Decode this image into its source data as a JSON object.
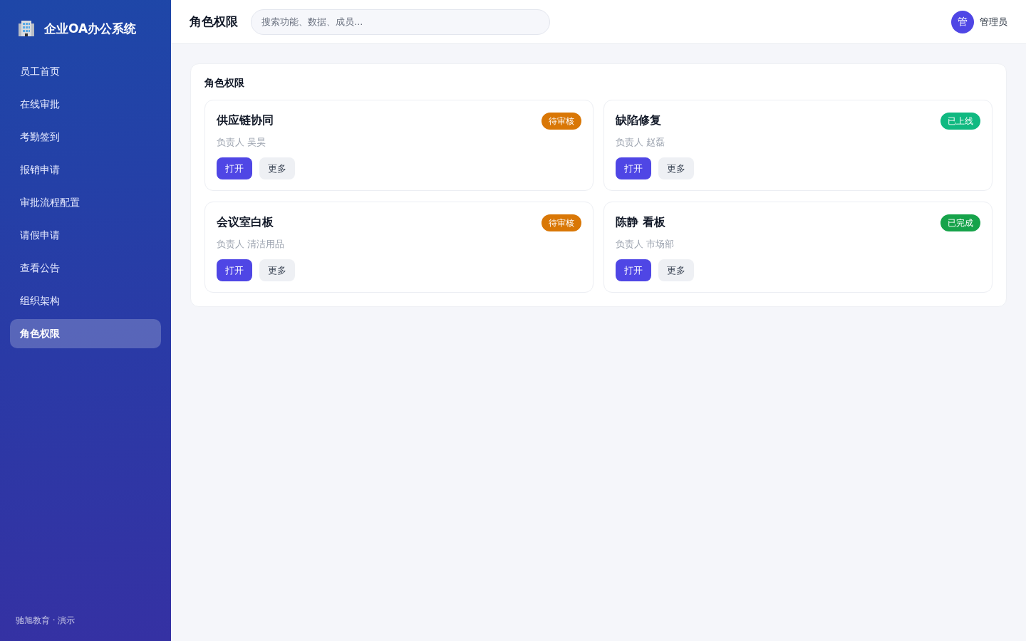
{
  "sidebar": {
    "logo": {
      "title": "企业OA办公系统"
    },
    "items": [
      {
        "label": "员工首页",
        "selected": false
      },
      {
        "label": "在线审批",
        "selected": false
      },
      {
        "label": "考勤签到",
        "selected": false
      },
      {
        "label": "报销申请",
        "selected": false
      },
      {
        "label": "审批流程配置",
        "selected": false
      },
      {
        "label": "请假申请",
        "selected": false
      },
      {
        "label": "查看公告",
        "selected": false
      },
      {
        "label": "组织架构",
        "selected": false
      },
      {
        "label": "角色权限",
        "selected": true
      }
    ],
    "footer": "驰旭教育 · 演示"
  },
  "header": {
    "title": "角色权限",
    "search": {
      "placeholder": "搜索功能、数据、成员..."
    },
    "user": {
      "avatar": "管",
      "name": "管理员"
    }
  },
  "panel": {
    "title": "角色权限",
    "cards": [
      {
        "title": "供应链协同",
        "owner": "负责人 吴昊",
        "badge": {
          "text": "待审核",
          "color": "#d97706"
        },
        "buttons": [
          "打开",
          "更多"
        ]
      },
      {
        "title": "缺陷修复",
        "owner": "负责人 赵磊",
        "badge": {
          "text": "已上线",
          "color": "#10b981"
        },
        "buttons": [
          "打开",
          "更多"
        ]
      },
      {
        "title": "会议室白板",
        "owner": "负责人 清洁用品",
        "badge": {
          "text": "待审核",
          "color": "#d97706"
        },
        "buttons": [
          "打开",
          "更多"
        ]
      },
      {
        "title": "陈静 看板",
        "owner": "负责人 市场部",
        "badge": {
          "text": "已完成",
          "color": "#16a34a"
        },
        "buttons": [
          "打开",
          "更多"
        ]
      }
    ]
  }
}
